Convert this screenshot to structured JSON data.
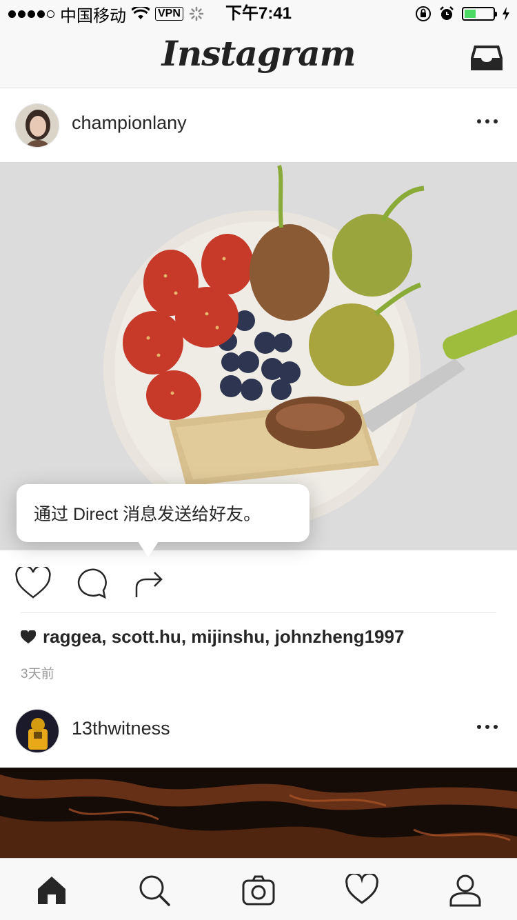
{
  "status_bar": {
    "carrier": "中国移动",
    "vpn": "VPN",
    "time": "下午7:41"
  },
  "nav": {
    "title": "Instagram",
    "inbox_icon": "inbox-icon"
  },
  "posts": [
    {
      "username": "championlany",
      "avatar": "avatar",
      "liked_by": "raggea, scott.hu, mijinshu, johnzheng1997",
      "time_ago": "3天前"
    },
    {
      "username": "13thwitness",
      "avatar": "avatar"
    }
  ],
  "tooltip": {
    "text": "通过 Direct 消息发送给好友。"
  },
  "actions": [
    "heart-icon",
    "comment-icon",
    "share-icon"
  ],
  "tabbar": [
    "home-icon",
    "search-icon",
    "camera-icon",
    "heart-icon",
    "profile-icon"
  ],
  "colors": {
    "battery": "#4cd964",
    "text": "#262626",
    "bar_bg": "#f8f8f8"
  }
}
